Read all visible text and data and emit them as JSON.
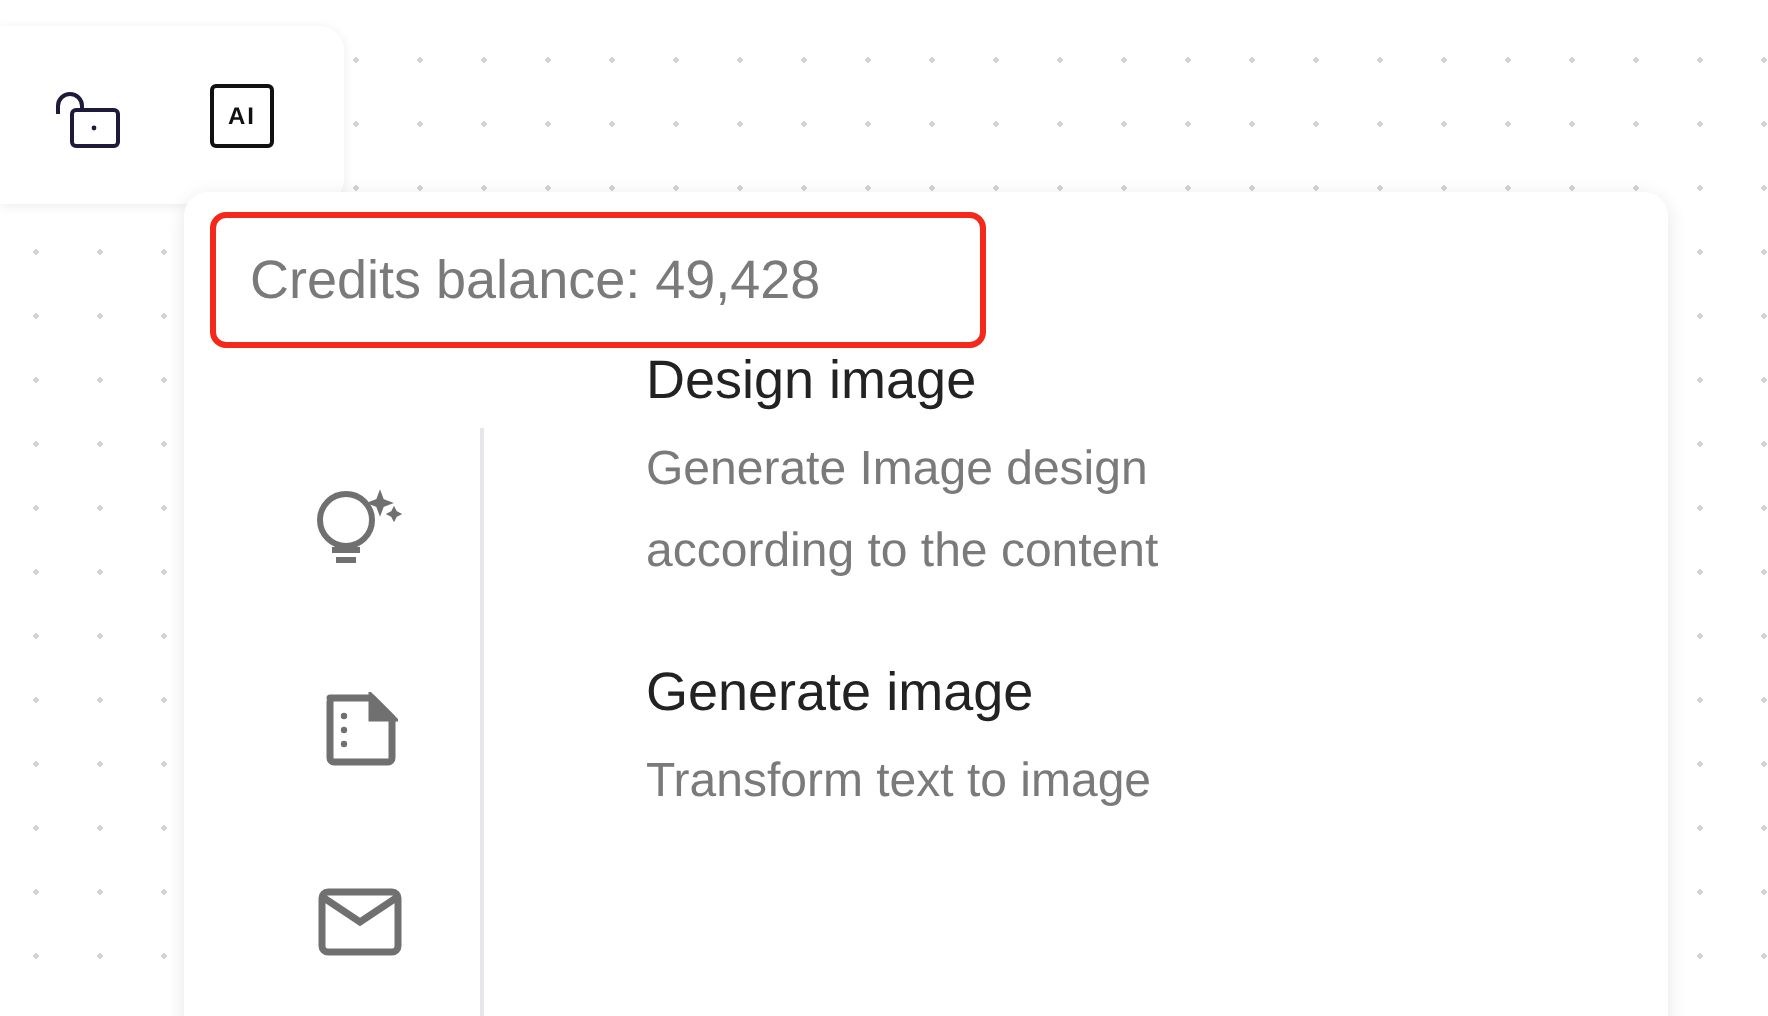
{
  "toolbar": {
    "ai_label": "AI"
  },
  "credits": {
    "text": "Credits balance: 49,428",
    "highlighted": true
  },
  "items": [
    {
      "title": "Design image",
      "description": "Generate Image design according to the content"
    },
    {
      "title": "Generate image",
      "description": "Transform text to image"
    }
  ]
}
